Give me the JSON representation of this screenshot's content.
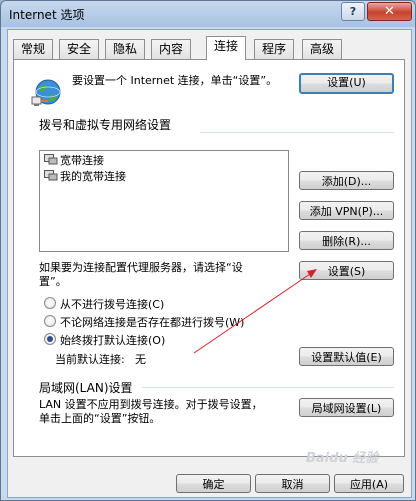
{
  "window": {
    "title": "Internet 选项",
    "help_label": "?",
    "close_label": "✕"
  },
  "tabs": [
    "常规",
    "安全",
    "隐私",
    "内容",
    "连接",
    "程序",
    "高级"
  ],
  "active_tab": "连接",
  "setup": {
    "text": "要设置一个 Internet 连接，单击“设置”。",
    "button": "设置(U)"
  },
  "dialup": {
    "heading": "拨号和虚拟专用网络设置",
    "items": [
      "宽带连接",
      "我的宽带连接"
    ],
    "add_button": "添加(D)...",
    "add_vpn_button": "添加 VPN(P)...",
    "remove_button": "删除(R)...",
    "proxy_text": "如果要为连接配置代理服务器，请选择“设置”。",
    "settings_button": "设置(S)",
    "options": [
      "从不进行拨号连接(C)",
      "不论网络连接是否存在都进行拨号(W)",
      "始终拨打默认连接(O)"
    ],
    "selected_option": 2,
    "current_default_label": "当前默认连接:",
    "current_default_value": "无",
    "set_default_button": "设置默认值(E)"
  },
  "lan": {
    "heading": "局域网(LAN)设置",
    "text": "LAN 设置不应用到拨号连接。对于拨号设置，单击上面的“设置”按钮。",
    "button": "局域网设置(L)"
  },
  "footer": {
    "ok": "确定",
    "cancel": "取消",
    "apply": "应用(A)"
  },
  "watermark": "Baidu 经验",
  "colors": {
    "annotation_arrow": "#d2222a",
    "default_button_border": "#3c7fb1"
  },
  "icons": {
    "setup": "globe-network-icon",
    "connection": "dialup-connection-icon"
  }
}
